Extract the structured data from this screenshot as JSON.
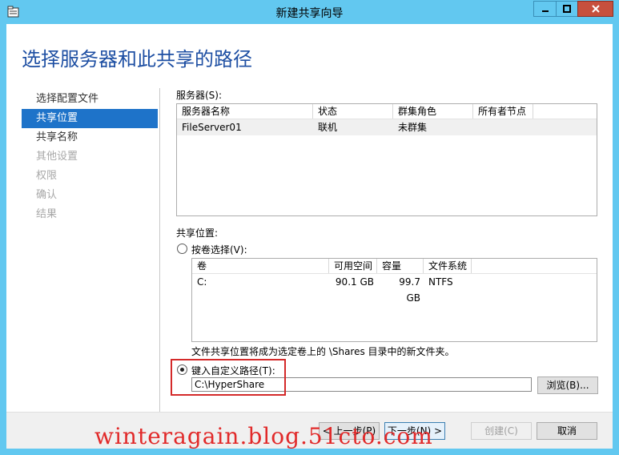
{
  "window": {
    "title": "新建共享向导",
    "icon": "wizard-folder-icon",
    "controls": {
      "minimize": "—",
      "maximize": "☐",
      "close": "✕"
    }
  },
  "heading": "选择服务器和此共享的路径",
  "nav": {
    "items": [
      {
        "label": "选择配置文件",
        "state": "normal"
      },
      {
        "label": "共享位置",
        "state": "active"
      },
      {
        "label": "共享名称",
        "state": "normal"
      },
      {
        "label": "其他设置",
        "state": "disabled"
      },
      {
        "label": "权限",
        "state": "disabled"
      },
      {
        "label": "确认",
        "state": "disabled"
      },
      {
        "label": "结果",
        "state": "disabled"
      }
    ]
  },
  "servers": {
    "label": "服务器(S):",
    "columns": [
      "服务器名称",
      "状态",
      "群集角色",
      "所有者节点"
    ],
    "rows": [
      [
        "FileServer01",
        "联机",
        "未群集",
        ""
      ]
    ]
  },
  "share_location": {
    "label": "共享位置:",
    "by_volume_label": "按卷选择(V):",
    "volume_columns": [
      "卷",
      "可用空间",
      "容量",
      "文件系统"
    ],
    "volume_rows": [
      [
        "C:",
        "90.1 GB",
        "99.7 GB",
        "NTFS"
      ]
    ],
    "note": "文件共享位置将成为选定卷上的 \\Shares 目录中的新文件夹。",
    "custom_path_label": "键入自定义路径(T):",
    "custom_path_value": "C:\\HyperShare",
    "browse_label": "浏览(B)..."
  },
  "footer": {
    "prev_label": "< 上一步(P)",
    "next_label": "下一步(N) >",
    "create_label": "创建(C)",
    "cancel_label": "取消"
  },
  "watermark": "winteragain.blog.51cto.com",
  "colors": {
    "titlebar": "#62c8f0",
    "heading": "#1e4fa3",
    "nav_active": "#1e73c9",
    "highlight": "#d42a2a",
    "close_button": "#c7503d"
  }
}
